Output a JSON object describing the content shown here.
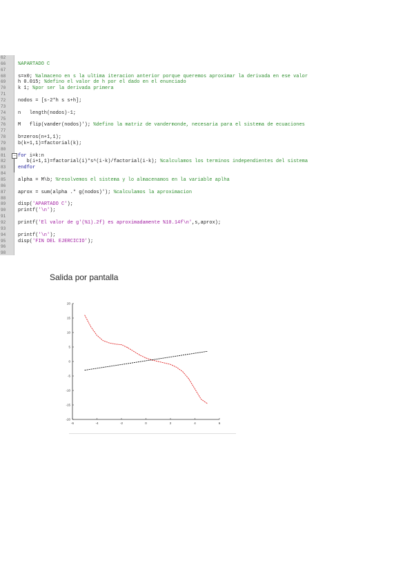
{
  "code": {
    "lines": [
      {
        "n": "62",
        "parts": []
      },
      {
        "n": "66",
        "parts": [
          {
            "t": "%APARTADO C",
            "c": "com"
          }
        ]
      },
      {
        "n": "67",
        "parts": []
      },
      {
        "n": "68",
        "parts": [
          {
            "t": "s=x0; ",
            "c": "txt"
          },
          {
            "t": "%almaceno en s la ultima iteracion anterior porque queremos aproximar la derivada en ese valor",
            "c": "com"
          }
        ]
      },
      {
        "n": "69",
        "parts": [
          {
            "t": "h 0.015; ",
            "c": "txt"
          },
          {
            "t": "%defino el valor de h por el dado en el enunciado",
            "c": "com"
          }
        ]
      },
      {
        "n": "70",
        "parts": [
          {
            "t": "k 1; ",
            "c": "txt"
          },
          {
            "t": "%por ser la derivada primera",
            "c": "com"
          }
        ]
      },
      {
        "n": "71",
        "parts": []
      },
      {
        "n": "72",
        "parts": [
          {
            "t": "nodos = [s-2*h s s+h];",
            "c": "txt"
          }
        ]
      },
      {
        "n": "73",
        "parts": []
      },
      {
        "n": "74",
        "parts": [
          {
            "t": "n   length(nodos)-1;",
            "c": "txt"
          }
        ]
      },
      {
        "n": "75",
        "parts": []
      },
      {
        "n": "76",
        "parts": [
          {
            "t": "M   flip(vander(nodos)'); ",
            "c": "txt"
          },
          {
            "t": "%defino la matriz de vandermonde, necesaria para el sistema de ecuaciones",
            "c": "com"
          }
        ]
      },
      {
        "n": "77",
        "parts": []
      },
      {
        "n": "78",
        "parts": [
          {
            "t": "b=zeros(n+1,1);",
            "c": "txt"
          }
        ]
      },
      {
        "n": "79",
        "parts": [
          {
            "t": "b(k+1,1)=factorial(k);",
            "c": "txt"
          }
        ]
      },
      {
        "n": "80",
        "parts": []
      },
      {
        "n": "81",
        "parts": [
          {
            "t": "for",
            "c": "kw"
          },
          {
            "t": " i=k:n",
            "c": "txt"
          }
        ]
      },
      {
        "n": "82",
        "parts": [
          {
            "t": "   b(i+1,1)=factorial(i)*s^(i-k)/factorial(i-k); ",
            "c": "txt"
          },
          {
            "t": "%calculamos los terminos independientes del sistema",
            "c": "com"
          }
        ]
      },
      {
        "n": "83",
        "parts": [
          {
            "t": "endfor",
            "c": "kw"
          }
        ]
      },
      {
        "n": "84",
        "parts": []
      },
      {
        "n": "85",
        "parts": [
          {
            "t": "alpha = M\\b; ",
            "c": "txt"
          },
          {
            "t": "%resolvemos el sistema y lo almacenamos en la variable aplha",
            "c": "com"
          }
        ]
      },
      {
        "n": "86",
        "parts": []
      },
      {
        "n": "87",
        "parts": [
          {
            "t": "aprox = sum(alpha .* g(nodos)'); ",
            "c": "txt"
          },
          {
            "t": "%calculamos la aproximacion",
            "c": "com"
          }
        ]
      },
      {
        "n": "88",
        "parts": []
      },
      {
        "n": "89",
        "parts": [
          {
            "t": "disp(",
            "c": "txt"
          },
          {
            "t": "'APARTADO C'",
            "c": "str"
          },
          {
            "t": ");",
            "c": "txt"
          }
        ]
      },
      {
        "n": "90",
        "parts": [
          {
            "t": "printf(",
            "c": "txt"
          },
          {
            "t": "'\\n'",
            "c": "str"
          },
          {
            "t": ");",
            "c": "txt"
          }
        ]
      },
      {
        "n": "91",
        "parts": []
      },
      {
        "n": "92",
        "parts": [
          {
            "t": "printf(",
            "c": "txt"
          },
          {
            "t": "'El valor de g'(%1).2f) es aproximadamente %10.14f\\n'",
            "c": "str"
          },
          {
            "t": ",s,aprox);",
            "c": "txt"
          }
        ]
      },
      {
        "n": "93",
        "parts": []
      },
      {
        "n": "94",
        "parts": [
          {
            "t": "printf(",
            "c": "txt"
          },
          {
            "t": "'\\n'",
            "c": "str"
          },
          {
            "t": ");",
            "c": "txt"
          }
        ]
      },
      {
        "n": "95",
        "parts": [
          {
            "t": "disp(",
            "c": "txt"
          },
          {
            "t": "'FIN DEL EJERCICIO'",
            "c": "str"
          },
          {
            "t": ");",
            "c": "txt"
          }
        ]
      },
      {
        "n": "96",
        "parts": []
      },
      {
        "n": "98",
        "parts": []
      }
    ]
  },
  "caption": "Salida por pantalla",
  "colors": {
    "curve": "#e02020",
    "line": "#111111",
    "comment": "#2f8f2f"
  },
  "chart_data": {
    "type": "line",
    "xlim": [
      -6,
      6
    ],
    "ylim": [
      -20,
      20
    ],
    "x_ticks": [
      "-6",
      "-4",
      "-2",
      "0",
      "2",
      "4",
      "6"
    ],
    "y_ticks": [
      "20",
      "15",
      "10",
      "5",
      "0",
      "-5",
      "-10",
      "-15",
      "-20"
    ],
    "grid": false,
    "legend": "none",
    "series": [
      {
        "style": "dashed",
        "color": "#e02020",
        "x": [
          -5,
          -4.5,
          -4,
          -3.5,
          -3,
          -2.5,
          -2,
          -1.5,
          -1,
          -0.5,
          0,
          0.5,
          1,
          1.5,
          2,
          2.5,
          3,
          3.5,
          4,
          4.5,
          5
        ],
        "y": [
          16,
          12,
          9,
          7.2,
          6.4,
          6,
          5.8,
          4.8,
          3.5,
          2.2,
          1.2,
          0.5,
          0,
          -0.5,
          -1,
          -2,
          -3.5,
          -6,
          -9.5,
          -13,
          -14.5
        ]
      },
      {
        "style": "dashed",
        "color": "#111111",
        "x": [
          -5,
          5
        ],
        "y": [
          -3,
          3.5
        ]
      }
    ]
  }
}
